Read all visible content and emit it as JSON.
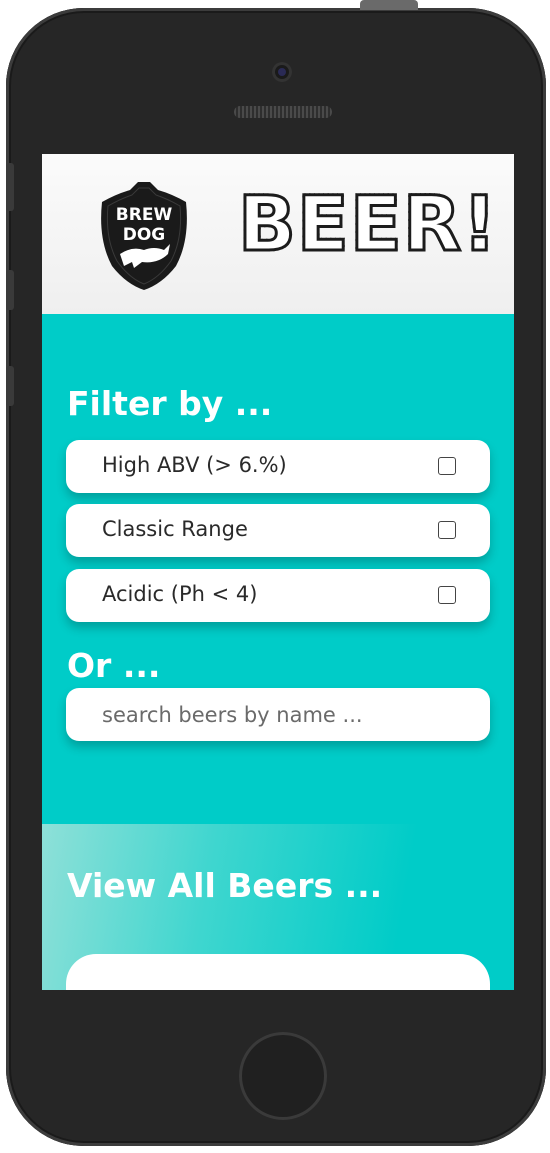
{
  "header": {
    "logo_alt": "BrewDog",
    "logo_text_top": "BREW",
    "logo_text_bottom": "DOG",
    "title": "BEER!"
  },
  "filters": {
    "title": "Filter by ...",
    "items": [
      {
        "label": "High ABV (> 6.%)",
        "checked": false
      },
      {
        "label": "Classic Range",
        "checked": false
      },
      {
        "label": "Acidic (Ph < 4)",
        "checked": false
      }
    ]
  },
  "search": {
    "title": "Or ...",
    "placeholder": "search beers by name ...",
    "value": ""
  },
  "all_beers": {
    "title": "View All Beers ..."
  },
  "colors": {
    "accent": "#00ccc8",
    "header_bg": "#f5f5f5",
    "card_bg": "#ffffff",
    "phone_body": "#262626"
  },
  "icons": [
    "brewdog-logo",
    "checkbox-icon"
  ]
}
